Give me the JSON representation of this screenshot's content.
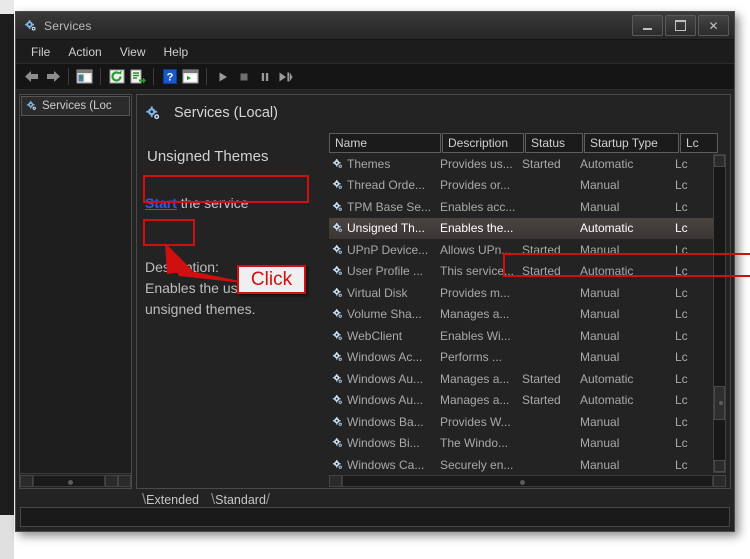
{
  "window": {
    "title": "Services",
    "title_icon": "gear-services-icon",
    "buttons": {
      "minimize": "minimize-icon",
      "maximize": "maximize-icon",
      "close": "close-icon"
    }
  },
  "menubar": {
    "items": [
      {
        "label": "File",
        "name": "menu-file"
      },
      {
        "label": "Action",
        "name": "menu-action"
      },
      {
        "label": "View",
        "name": "menu-view"
      },
      {
        "label": "Help",
        "name": "menu-help"
      }
    ]
  },
  "toolbar": {
    "buttons": [
      {
        "name": "back-icon",
        "glyph": "⬅"
      },
      {
        "name": "forward-icon",
        "glyph": "➡"
      },
      {
        "name": "show-hide-console-tree-icon",
        "glyph": "▤"
      },
      {
        "name": "refresh-icon",
        "glyph": "↻"
      },
      {
        "name": "export-list-icon",
        "glyph": "☰"
      },
      {
        "name": "help-icon",
        "glyph": "?"
      },
      {
        "name": "properties-icon",
        "glyph": "▣"
      },
      {
        "name": "start-service-icon",
        "glyph": "▶"
      },
      {
        "name": "stop-service-icon",
        "glyph": "■"
      },
      {
        "name": "pause-service-icon",
        "glyph": "‖"
      },
      {
        "name": "restart-service-icon",
        "glyph": "▶‖"
      }
    ]
  },
  "tree_pane": {
    "root_label": "Services (Loc",
    "root_icon": "gear-services-icon"
  },
  "detail_pane": {
    "title": "Services (Local)",
    "title_icon": "gear-services-icon",
    "service_name": "Unsigned Themes",
    "start_link": "Start",
    "start_suffix": " the service",
    "description_label": "Description:",
    "description_lines": [
      "Enables the use of",
      "unsigned themes."
    ]
  },
  "annotations": {
    "callout_label": "Click",
    "accent_color": "#d01010",
    "boxes": [
      {
        "name": "annotation-box-service-name"
      },
      {
        "name": "annotation-box-start-link"
      },
      {
        "name": "annotation-box-selected-row"
      }
    ]
  },
  "list": {
    "columns": [
      {
        "label": "Name",
        "key": "name"
      },
      {
        "label": "Description",
        "key": "description"
      },
      {
        "label": "Status",
        "key": "status"
      },
      {
        "label": "Startup Type",
        "key": "startup"
      },
      {
        "label": "Lc",
        "key": "logon"
      }
    ],
    "rows": [
      {
        "name": "Themes",
        "description": "Provides us...",
        "status": "Started",
        "startup": "Automatic",
        "logon": "Lc",
        "selected": false
      },
      {
        "name": "Thread Orde...",
        "description": "Provides or...",
        "status": "",
        "startup": "Manual",
        "logon": "Lc",
        "selected": false
      },
      {
        "name": "TPM Base Se...",
        "description": "Enables acc...",
        "status": "",
        "startup": "Manual",
        "logon": "Lc",
        "selected": false
      },
      {
        "name": "Unsigned Th...",
        "description": "Enables the...",
        "status": "",
        "startup": "Automatic",
        "logon": "Lc",
        "selected": true
      },
      {
        "name": "UPnP Device...",
        "description": "Allows UPn...",
        "status": "Started",
        "startup": "Manual",
        "logon": "Lc",
        "selected": false
      },
      {
        "name": "User Profile ...",
        "description": "This service...",
        "status": "Started",
        "startup": "Automatic",
        "logon": "Lc",
        "selected": false
      },
      {
        "name": "Virtual Disk",
        "description": "Provides m...",
        "status": "",
        "startup": "Manual",
        "logon": "Lc",
        "selected": false
      },
      {
        "name": "Volume Sha...",
        "description": "Manages a...",
        "status": "",
        "startup": "Manual",
        "logon": "Lc",
        "selected": false
      },
      {
        "name": "WebClient",
        "description": "Enables Wi...",
        "status": "",
        "startup": "Manual",
        "logon": "Lc",
        "selected": false
      },
      {
        "name": "Windows Ac...",
        "description": "Performs ...",
        "status": "",
        "startup": "Manual",
        "logon": "Lc",
        "selected": false
      },
      {
        "name": "Windows Au...",
        "description": "Manages a...",
        "status": "Started",
        "startup": "Automatic",
        "logon": "Lc",
        "selected": false
      },
      {
        "name": "Windows Au...",
        "description": "Manages a...",
        "status": "Started",
        "startup": "Automatic",
        "logon": "Lc",
        "selected": false
      },
      {
        "name": "Windows Ba...",
        "description": "Provides W...",
        "status": "",
        "startup": "Manual",
        "logon": "Lc",
        "selected": false
      },
      {
        "name": "Windows Bi...",
        "description": "The Windo...",
        "status": "",
        "startup": "Manual",
        "logon": "Lc",
        "selected": false
      },
      {
        "name": "Windows Ca...",
        "description": "Securely en...",
        "status": "",
        "startup": "Manual",
        "logon": "Lc",
        "selected": false
      }
    ]
  },
  "tabs": [
    {
      "label": "Extended",
      "name": "tab-extended",
      "active": false
    },
    {
      "label": "Standard",
      "name": "tab-standard",
      "active": true
    }
  ],
  "statusbar": {
    "text": ""
  }
}
